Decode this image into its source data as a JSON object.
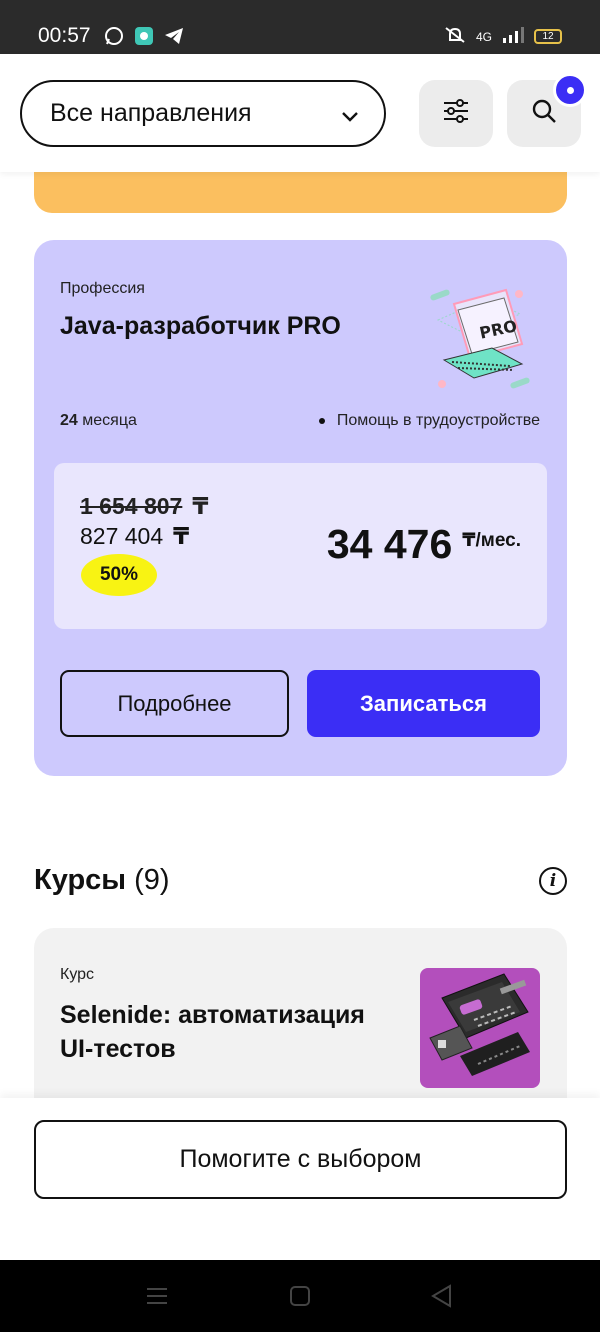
{
  "status_bar": {
    "time": "00:57",
    "network": "4G",
    "battery": "12",
    "icons": [
      "whatsapp-icon",
      "app-icon",
      "telegram-icon",
      "mute-icon",
      "signal-icon",
      "battery-icon"
    ]
  },
  "header": {
    "direction_select": "Все направления",
    "filter_icon": "filter-sliders-icon",
    "search_icon": "search-icon"
  },
  "profession_card": {
    "kind": "Профессия",
    "title": "Java-разработчик PRO",
    "duration_value": "24",
    "duration_unit": "месяца",
    "feature": "Помощь в трудоустройстве",
    "old_price": "1 654 807",
    "new_price": "827 404",
    "currency": "₸",
    "discount": "50%",
    "monthly_price": "34 476",
    "monthly_unit": "₸/мес.",
    "more_label": "Подробнее",
    "enroll_label": "Записаться"
  },
  "courses": {
    "title": "Курсы",
    "count": "(9)",
    "items": [
      {
        "kind": "Курс",
        "title": "Selenide: автоматизация UI-тестов"
      }
    ]
  },
  "help_button": "Помогите с выбором",
  "colors": {
    "accent": "#3b2ef5",
    "profession_card_bg": "#cdc9fd",
    "price_box_bg": "#e9e6fd",
    "discount_badge": "#f8f313",
    "orange_strip": "#fbbf5f",
    "course_card_bg": "#f2f2f2",
    "course_illustration_bg": "#b34fbc"
  }
}
